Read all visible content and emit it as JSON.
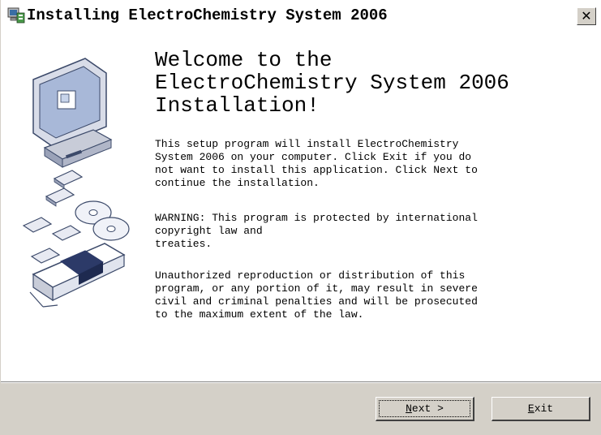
{
  "window": {
    "title": "Installing ElectroChemistry System 2006",
    "close_glyph": "✕"
  },
  "content": {
    "heading": "Welcome to the\nElectroChemistry System 2006\nInstallation!",
    "paragraph1": "This setup program will install ElectroChemistry\nSystem 2006 on your computer. Click Exit if you do\nnot want to install this application. Click Next to\ncontinue the installation.",
    "paragraph2": "WARNING: This program is protected by international\ncopyright law and\ntreaties.",
    "paragraph3": "Unauthorized reproduction or distribution of this\nprogram, or any portion of it, may result in severe\ncivil and criminal penalties and will be prosecuted\nto the maximum extent of the law."
  },
  "buttons": {
    "next": {
      "accel": "N",
      "rest": "ext >"
    },
    "exit": {
      "accel": "E",
      "rest": "xit"
    }
  },
  "icons": {
    "title_icon": "setup-computer-icon",
    "art": "computer-disks-box-illustration"
  }
}
